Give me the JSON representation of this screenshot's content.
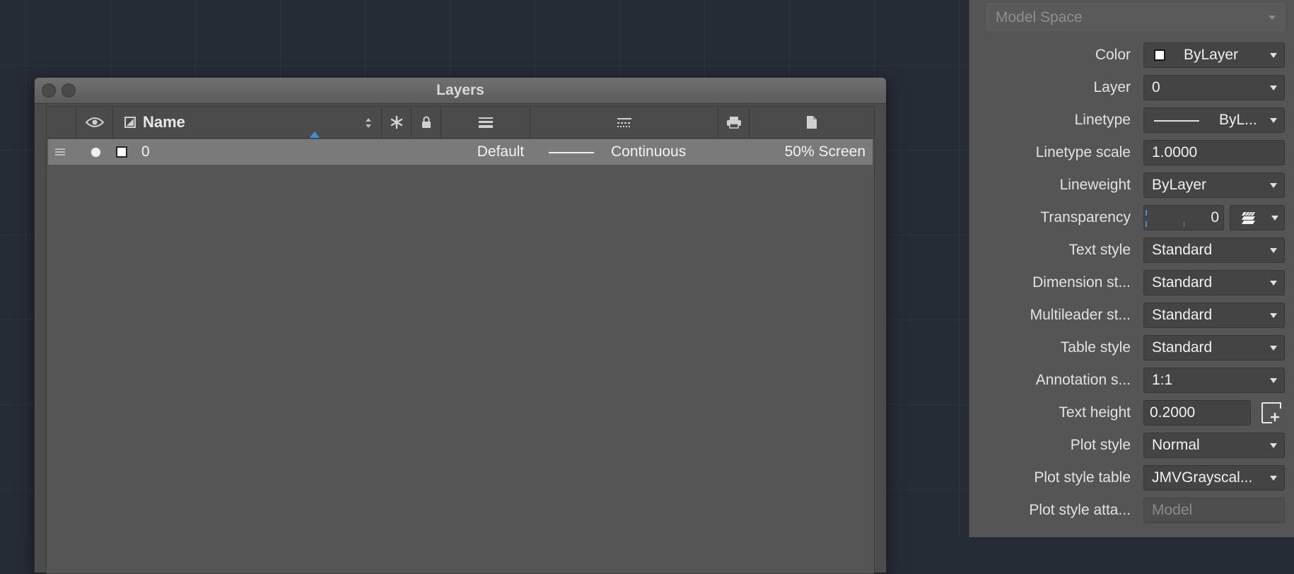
{
  "layers_window": {
    "title": "Layers",
    "columns": {
      "name": "Name"
    },
    "rows": [
      {
        "name": "0",
        "color": "#ffffff",
        "linetype_label": "Default",
        "linetype": "Continuous",
        "plot_style": "50% Screen"
      }
    ]
  },
  "properties": {
    "space_dropdown": "Model Space",
    "items": [
      {
        "label": "Color",
        "value": "ByLayer"
      },
      {
        "label": "Layer",
        "value": "0"
      },
      {
        "label": "Linetype",
        "value": "ByL..."
      },
      {
        "label": "Linetype scale",
        "value": "1.0000"
      },
      {
        "label": "Lineweight",
        "value": "ByLayer"
      },
      {
        "label": "Transparency",
        "value": "0"
      },
      {
        "label": "Text style",
        "value": "Standard"
      },
      {
        "label": "Dimension st...",
        "value": "Standard"
      },
      {
        "label": "Multileader st...",
        "value": "Standard"
      },
      {
        "label": "Table style",
        "value": "Standard"
      },
      {
        "label": "Annotation s...",
        "value": "1:1"
      },
      {
        "label": "Text height",
        "value": "0.2000"
      },
      {
        "label": "Plot style",
        "value": "Normal"
      },
      {
        "label": "Plot style table",
        "value": "JMVGrayscal..."
      },
      {
        "label": "Plot style atta...",
        "value": "Model"
      }
    ]
  },
  "colors": {
    "accent": "#3f8fe0",
    "canvas": "#262c36",
    "panel": "#555555"
  }
}
